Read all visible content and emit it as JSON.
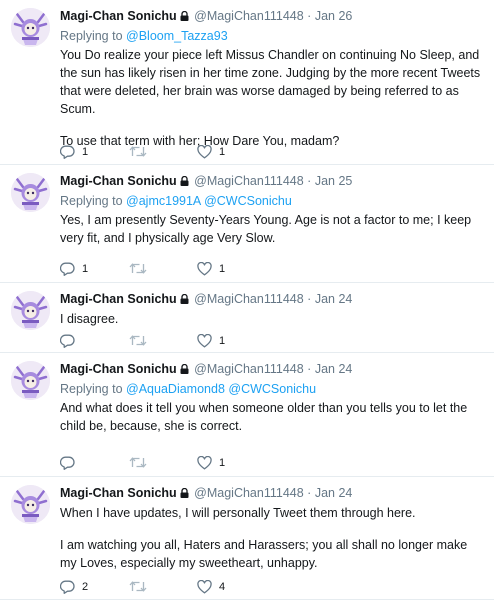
{
  "tweets": [
    {
      "name": "Magi-Chan Sonichu",
      "handle": "@MagiChan111448",
      "dot": "·",
      "date": "Jan 26",
      "reply_prefix": "Replying to",
      "mentions": [
        "@Bloom_Tazza93"
      ],
      "paragraphs": [
        "You Do realize your piece left Missus Chandler on continuing No Sleep, and the sun has likely risen in her time zone. Judging by the more recent Tweets that were deleted, her brain was worse damaged by being referred to as Scum.",
        "To use that term with her; How Dare You, madam?"
      ],
      "replies": "1",
      "retweets": "",
      "likes": "1"
    },
    {
      "name": "Magi-Chan Sonichu",
      "handle": "@MagiChan111448",
      "dot": "·",
      "date": "Jan 25",
      "reply_prefix": "Replying to",
      "mentions": [
        "@ajmc1991A",
        "@CWCSonichu"
      ],
      "paragraphs": [
        "Yes, I am presently Seventy-Years Young. Age is not a factor to me; I keep very fit, and I physically age Very Slow."
      ],
      "replies": "1",
      "retweets": "",
      "likes": "1"
    },
    {
      "name": "Magi-Chan Sonichu",
      "handle": "@MagiChan111448",
      "dot": "·",
      "date": "Jan 24",
      "reply_prefix": "",
      "mentions": [],
      "paragraphs": [
        "I disagree."
      ],
      "replies": "",
      "retweets": "",
      "likes": "1"
    },
    {
      "name": "Magi-Chan Sonichu",
      "handle": "@MagiChan111448",
      "dot": "·",
      "date": "Jan 24",
      "reply_prefix": "Replying to",
      "mentions": [
        "@AquaDiamond8",
        "@CWCSonichu"
      ],
      "paragraphs": [
        "And what does it tell you when someone older than you tells you to let the child be, because, she is correct."
      ],
      "replies": "",
      "retweets": "",
      "likes": "1"
    },
    {
      "name": "Magi-Chan Sonichu",
      "handle": "@MagiChan111448",
      "dot": "·",
      "date": "Jan 24",
      "reply_prefix": "",
      "mentions": [],
      "paragraphs": [
        "When I have updates, I will personally Tweet them through here.",
        "I am watching you all, Haters and Harassers; you all shall no longer make my Loves, especially my sweetheart, unhappy."
      ],
      "replies": "2",
      "retweets": "",
      "likes": "4"
    }
  ],
  "colors": {
    "text": "#14171a",
    "muted": "#657786",
    "link": "#1da1f2",
    "border": "#e6ecf0"
  },
  "icons": {
    "reply": "reply-icon",
    "retweet": "retweet-icon",
    "like": "heart-icon",
    "lock": "lock-icon"
  }
}
